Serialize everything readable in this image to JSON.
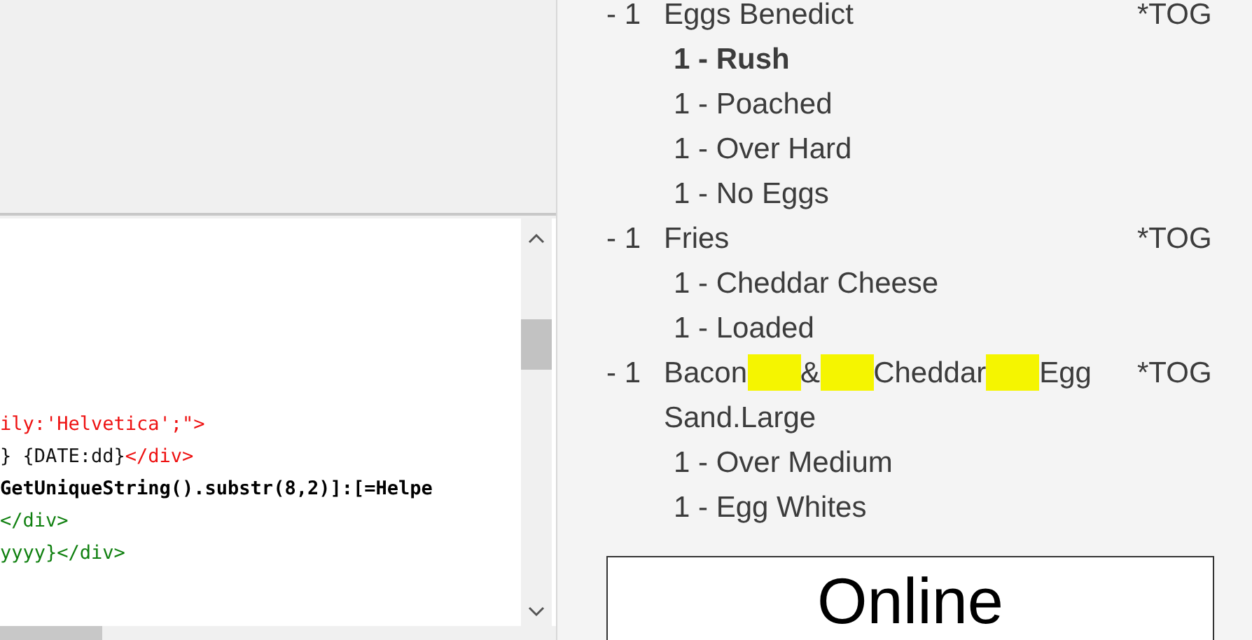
{
  "code_editor": {
    "lines": [
      {
        "tokens": [
          {
            "kind": "tag",
            "text": "ily:'Helvetica';\">"
          }
        ]
      },
      {
        "tokens": [
          {
            "kind": "plain",
            "text": "} {DATE:dd}"
          },
          {
            "kind": "tag",
            "text": "</div>"
          }
        ]
      },
      {
        "tokens": [
          {
            "kind": "bold",
            "text": "GetUniqueString().substr(8,2)]:[=Helpe"
          }
        ]
      },
      {
        "tokens": [
          {
            "kind": "green",
            "text": "</div>"
          }
        ]
      },
      {
        "tokens": [
          {
            "kind": "green",
            "text": "yyyy}</div>"
          }
        ]
      }
    ]
  },
  "order_items": [
    {
      "qty": "- 1",
      "name_parts": [
        {
          "text": "Eggs Benedict",
          "highlight_after": false
        }
      ],
      "tag": "*TOG",
      "modifiers": [
        {
          "text": "1 - Rush",
          "emphasized": true
        },
        {
          "text": "1 - Poached",
          "emphasized": false
        },
        {
          "text": "1 - Over Hard",
          "emphasized": false
        },
        {
          "text": "1 - No Eggs",
          "emphasized": false
        }
      ]
    },
    {
      "qty": "- 1",
      "name_parts": [
        {
          "text": "Fries",
          "highlight_after": false
        }
      ],
      "tag": "*TOG",
      "modifiers": [
        {
          "text": "1 - Cheddar Cheese",
          "emphasized": false
        },
        {
          "text": "1 - Loaded",
          "emphasized": false
        }
      ]
    },
    {
      "qty": "- 1",
      "name_parts": [
        {
          "text": "Bacon",
          "highlight_after": true
        },
        {
          "text": "&",
          "highlight_after": true
        },
        {
          "text": "Cheddar",
          "highlight_after": true
        },
        {
          "text": "Egg Sand.Large",
          "highlight_after": false
        }
      ],
      "tag": "*TOG",
      "modifiers": [
        {
          "text": "1 - Over Medium",
          "emphasized": false
        },
        {
          "text": "1 - Egg Whites",
          "emphasized": false
        }
      ]
    }
  ],
  "status_box": {
    "text": "Online"
  }
}
